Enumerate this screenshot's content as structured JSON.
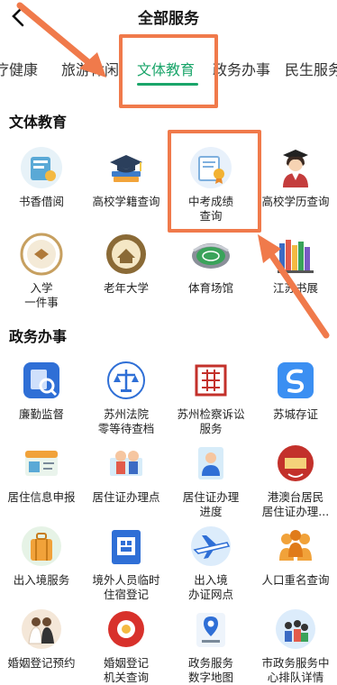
{
  "header": {
    "title": "全部服务"
  },
  "tabs": [
    {
      "label": "疗健康"
    },
    {
      "label": "旅游休闲"
    },
    {
      "label": "文体教育",
      "active": true
    },
    {
      "label": "政务办事"
    },
    {
      "label": "民生服务"
    }
  ],
  "sections": [
    {
      "title": "文体教育",
      "items": [
        {
          "label_lines": [
            "书香借阅"
          ],
          "icon": "book-borrow-icon"
        },
        {
          "label_lines": [
            "高校学籍查询"
          ],
          "icon": "graduation-cap-books-icon"
        },
        {
          "label_lines": [
            "中考成绩",
            "查询"
          ],
          "icon": "certificate-icon"
        },
        {
          "label_lines": [
            "高校学历查询"
          ],
          "icon": "graduate-student-icon"
        },
        {
          "label_lines": [
            "入学",
            "一件事"
          ],
          "icon": "school-badge-icon"
        },
        {
          "label_lines": [
            "老年大学"
          ],
          "icon": "elderly-university-icon"
        },
        {
          "label_lines": [
            "体育场馆"
          ],
          "icon": "stadium-icon"
        },
        {
          "label_lines": [
            "江苏书展"
          ],
          "icon": "bookshelf-icon"
        }
      ]
    },
    {
      "title": "政务办事",
      "items": [
        {
          "label_lines": [
            "廉勤监督"
          ],
          "icon": "supervision-icon"
        },
        {
          "label_lines": [
            "苏州法院",
            "零等待查档"
          ],
          "icon": "court-scale-icon"
        },
        {
          "label_lines": [
            "苏州检察诉讼",
            "服务"
          ],
          "icon": "procuratorate-seal-icon"
        },
        {
          "label_lines": [
            "苏城存证"
          ],
          "icon": "evidence-storage-icon"
        },
        {
          "label_lines": [
            "居住信息申报"
          ],
          "icon": "residence-report-icon"
        },
        {
          "label_lines": [
            "居住证办理点"
          ],
          "icon": "residence-permit-office-icon"
        },
        {
          "label_lines": [
            "居住证办理",
            "进度"
          ],
          "icon": "progress-person-icon"
        },
        {
          "label_lines": [
            "港澳台居民",
            "居住证办理..."
          ],
          "icon": "residence-permit-stamp-icon"
        },
        {
          "label_lines": [
            "出入境服务"
          ],
          "icon": "luggage-icon"
        },
        {
          "label_lines": [
            "境外人员临时",
            "住宿登记"
          ],
          "icon": "foreigner-lodging-icon"
        },
        {
          "label_lines": [
            "出入境",
            "办证网点"
          ],
          "icon": "airplane-icon"
        },
        {
          "label_lines": [
            "人口重名查询"
          ],
          "icon": "people-search-icon"
        },
        {
          "label_lines": [
            "婚姻登记预约"
          ],
          "icon": "wedding-couple-icon"
        },
        {
          "label_lines": [
            "婚姻登记",
            "机关查询"
          ],
          "icon": "marriage-office-icon"
        },
        {
          "label_lines": [
            "政务服务",
            "数字地图"
          ],
          "icon": "digital-map-icon"
        },
        {
          "label_lines": [
            "市政务服务中",
            "心排队详情"
          ],
          "icon": "queue-detail-icon"
        }
      ]
    }
  ],
  "colors": {
    "accent": "#1aa56a",
    "annotation": "#f07a4b"
  }
}
